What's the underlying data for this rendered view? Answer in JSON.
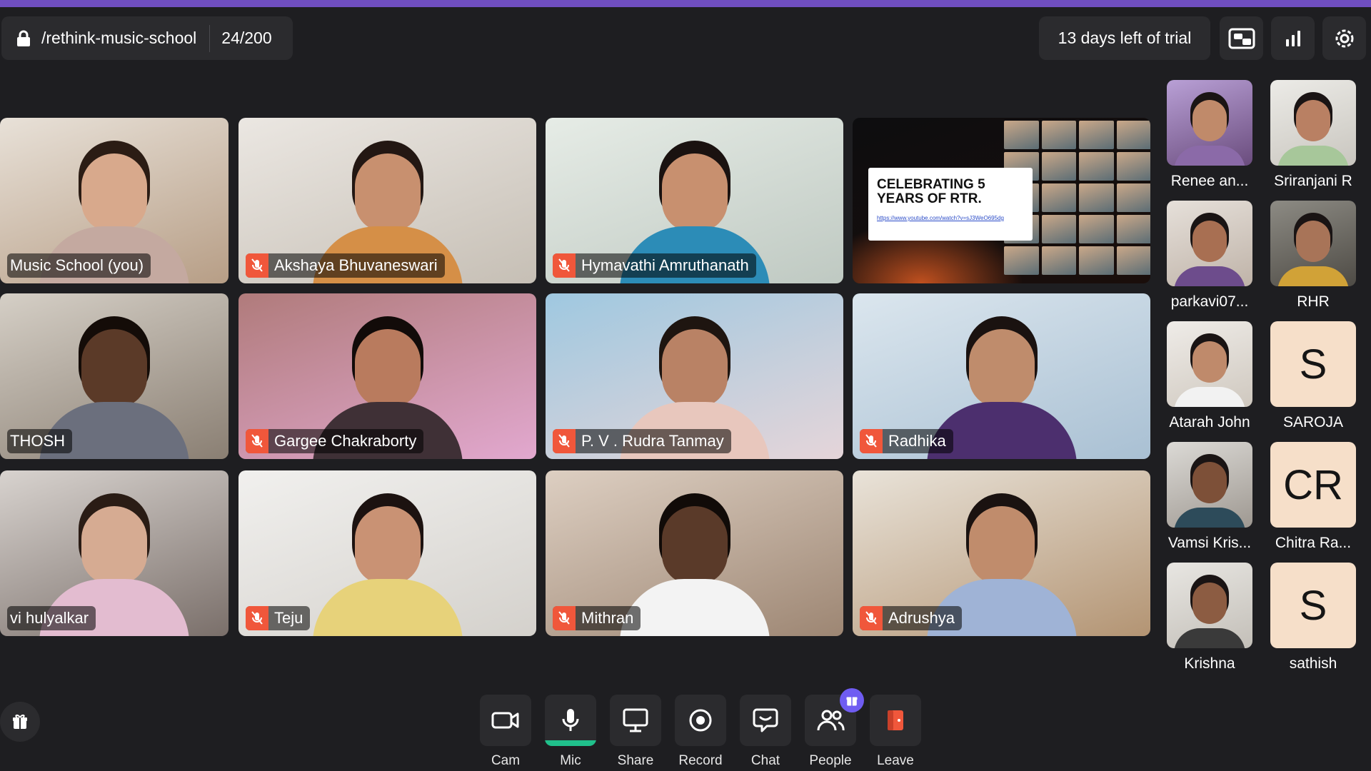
{
  "top_bar": {
    "room_name": "/rethink-music-school",
    "participant_count": "24/200",
    "trial_text": "13 days left of trial",
    "icons": [
      "lock-icon",
      "picture-in-picture-icon",
      "stats-icon",
      "settings-icon"
    ]
  },
  "colors": {
    "accent": "#6f4ec0",
    "mute_badge": "#f0573b",
    "mic_active": "#20c08b",
    "badge": "#6f5cf2"
  },
  "tiles": [
    {
      "name": "Music School (you)",
      "muted": false
    },
    {
      "name": "Akshaya Bhuvaneswari",
      "muted": true
    },
    {
      "name": "Hymavathi Amruthanath",
      "muted": true
    },
    {
      "name": "THOSH",
      "muted": false
    },
    {
      "name": "Gargee Chakraborty",
      "muted": true
    },
    {
      "name": "P. V . Rudra Tanmay",
      "muted": true
    },
    {
      "name": "Radhika",
      "muted": true
    },
    {
      "name": "vi hulyalkar",
      "muted": false
    },
    {
      "name": "Teju",
      "muted": true
    },
    {
      "name": "Mithran",
      "muted": true
    },
    {
      "name": "Adrushya",
      "muted": true
    }
  ],
  "screen_share": {
    "title": "CELEBRATING 5 YEARS OF RTR.",
    "link": "https://www.youtube.com/watch?v=sJ3WeO695dg"
  },
  "sidebar": [
    {
      "name": "Renee an...",
      "initial": ""
    },
    {
      "name": "Sriranjani R",
      "initial": ""
    },
    {
      "name": "parkavi07...",
      "initial": ""
    },
    {
      "name": "RHR",
      "initial": ""
    },
    {
      "name": "Atarah John",
      "initial": ""
    },
    {
      "name": "SAROJA",
      "initial": "S"
    },
    {
      "name": "Vamsi Kris...",
      "initial": ""
    },
    {
      "name": "Chitra Ra...",
      "initial": "CR"
    },
    {
      "name": "Krishna",
      "initial": ""
    },
    {
      "name": "sathish",
      "initial": "S"
    }
  ],
  "toolbar": {
    "cam": "Cam",
    "mic": "Mic",
    "share": "Share",
    "record": "Record",
    "chat": "Chat",
    "people": "People",
    "leave": "Leave"
  }
}
